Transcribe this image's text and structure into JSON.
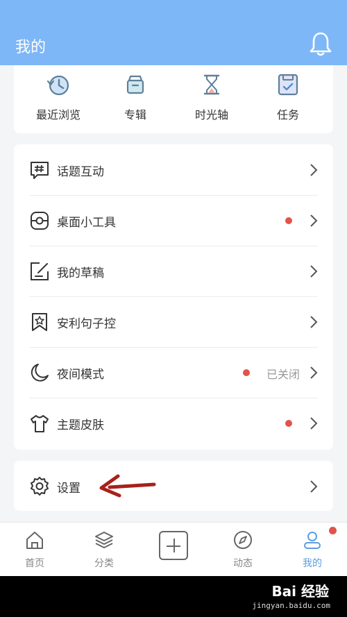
{
  "header": {
    "title": "我的",
    "icon": "bell-icon"
  },
  "quick_access": [
    {
      "label": "最近浏览",
      "icon": "history-clock-icon"
    },
    {
      "label": "专辑",
      "icon": "album-box-icon"
    },
    {
      "label": "时光轴",
      "icon": "hourglass-icon"
    },
    {
      "label": "任务",
      "icon": "task-checkbox-icon"
    }
  ],
  "menu": [
    {
      "label": "话题互动",
      "icon": "hashtag-chat-icon",
      "badge": false,
      "status": ""
    },
    {
      "label": "桌面小工具",
      "icon": "widget-icon",
      "badge": true,
      "status": ""
    },
    {
      "label": "我的草稿",
      "icon": "edit-draft-icon",
      "badge": false,
      "status": ""
    },
    {
      "label": "安利句子控",
      "icon": "star-bookmark-icon",
      "badge": false,
      "status": ""
    },
    {
      "label": "夜间模式",
      "icon": "moon-icon",
      "badge": true,
      "status": "已关闭"
    },
    {
      "label": "主题皮肤",
      "icon": "tshirt-icon",
      "badge": true,
      "status": ""
    }
  ],
  "settings": {
    "label": "设置",
    "icon": "gear-icon"
  },
  "tabs": [
    {
      "label": "首页",
      "icon": "home-icon",
      "active": false
    },
    {
      "label": "分类",
      "icon": "layers-icon",
      "active": false
    },
    {
      "label": "",
      "icon": "add-icon",
      "active": false
    },
    {
      "label": "动态",
      "icon": "compass-icon",
      "active": false
    },
    {
      "label": "我的",
      "icon": "profile-icon",
      "active": true
    }
  ],
  "watermark": {
    "brand": "Bai 经验",
    "url": "jingyan.baidu.com"
  },
  "colors": {
    "header": "#7db7f7",
    "badge": "#e0544c",
    "active_tab": "#5a9ee0",
    "annotation_arrow": "#a8201a"
  }
}
